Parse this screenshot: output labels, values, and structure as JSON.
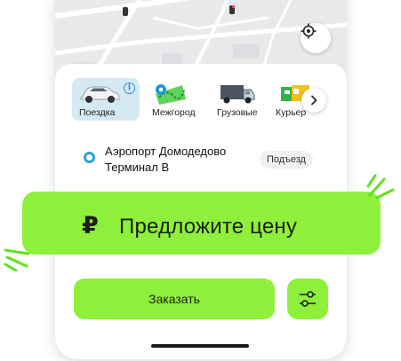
{
  "map": {
    "locate_icon": "locate-crosshair-icon"
  },
  "tariffs": [
    {
      "label": "Поездка",
      "icon": "sedan-car-icon",
      "active": true,
      "has_info": true
    },
    {
      "label": "Межгород",
      "icon": "intercity-route-icon",
      "active": false,
      "has_info": false
    },
    {
      "label": "Грузовые",
      "icon": "cargo-truck-icon",
      "active": false,
      "has_info": false
    },
    {
      "label": "Курьер",
      "icon": "courier-parcel-icon",
      "active": false,
      "has_info": false
    }
  ],
  "tariff_info_glyph": "i",
  "route": {
    "pickup_line1": "Аэропорт Домодедово",
    "pickup_line2": "Терминал B",
    "entrance_label": "Подъезд"
  },
  "price_banner": {
    "currency_symbol": "₽",
    "label": "Предложите цену"
  },
  "actions": {
    "order_label": "Заказать",
    "options_icon": "sliders-settings-icon"
  },
  "colors": {
    "accent_green": "#8ef03a",
    "active_tariff_bg": "#d3eaf3",
    "pickup_dot": "#29a3d8",
    "spark_green": "#5fe21a"
  }
}
